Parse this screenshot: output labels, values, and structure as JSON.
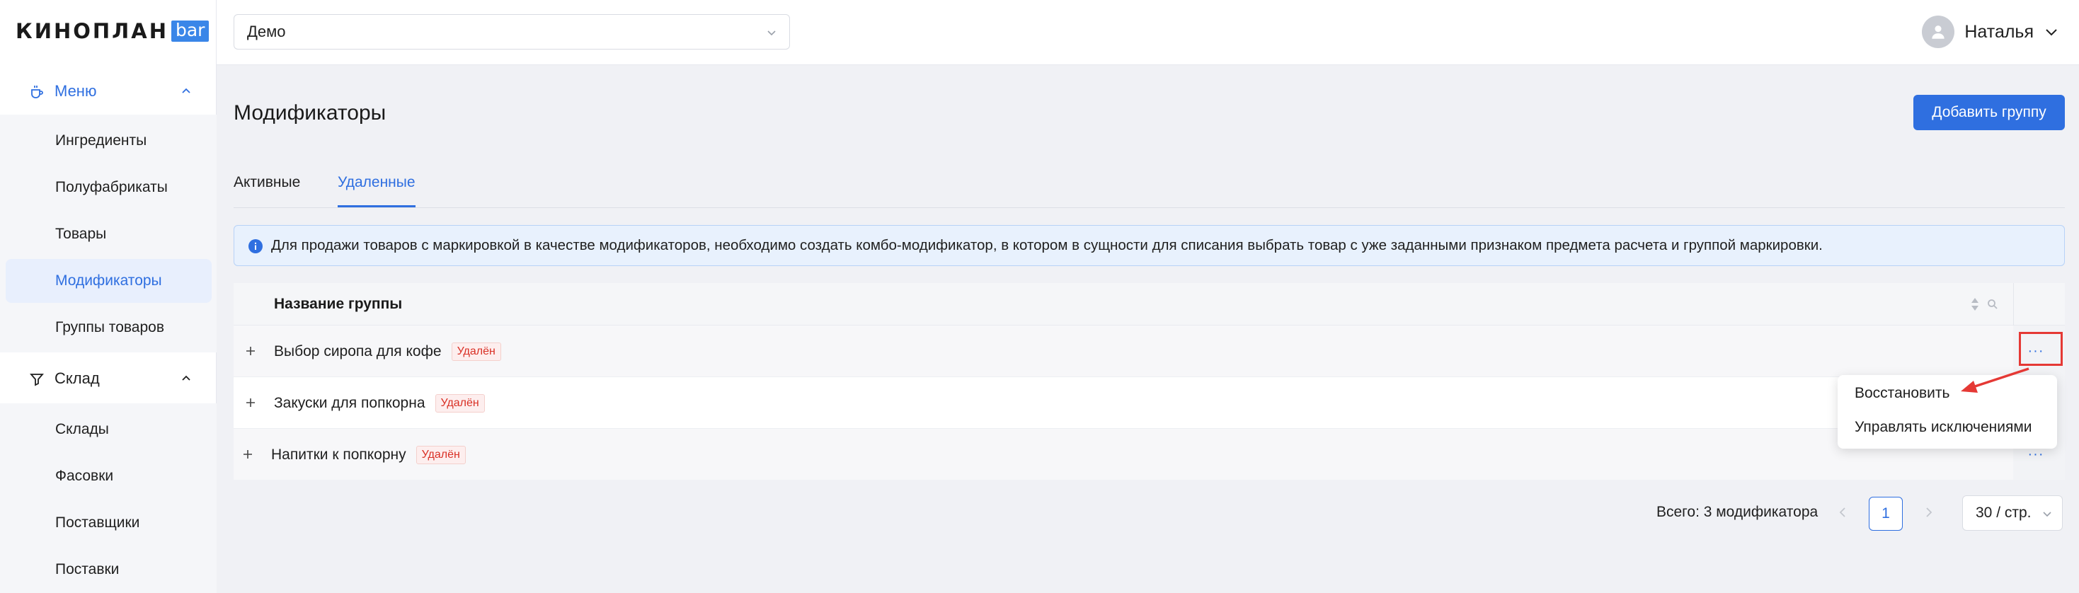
{
  "logo": {
    "text": "КИНОПЛАН",
    "badge": "bar"
  },
  "sidebar": {
    "menu_group": {
      "label": "Меню",
      "icon": "coffee-cup-icon",
      "items": [
        "Ингредиенты",
        "Полуфабрикаты",
        "Товары",
        "Модификаторы",
        "Группы товаров"
      ],
      "active_index": 3
    },
    "sklad_group": {
      "label": "Склад",
      "icon": "filter-icon",
      "items": [
        "Склады",
        "Фасовки",
        "Поставщики",
        "Поставки"
      ]
    }
  },
  "header": {
    "cinema_select": "Демо",
    "user_name": "Наталья"
  },
  "page": {
    "title": "Модификаторы",
    "add_button": "Добавить группу"
  },
  "tabs": [
    "Активные",
    "Удаленные"
  ],
  "active_tab": 1,
  "info_banner": "Для продажи товаров с маркировкой в качестве модификаторов, необходимо создать комбо-модификатор, в котором в сущности для списания выбрать товар с уже заданными признаком предмета расчета и группой маркировки.",
  "table": {
    "column_title": "Название группы",
    "rows": [
      {
        "name": "Выбор сиропа для кофе",
        "status": "Удалён"
      },
      {
        "name": "Закуски для попкорна",
        "status": "Удалён"
      },
      {
        "name": "Напитки к попкорну",
        "status": "Удалён"
      }
    ],
    "more_label": "···"
  },
  "context_menu": {
    "items": [
      "Восстановить",
      "Управлять исключениями"
    ]
  },
  "pagination": {
    "total": "Всего: 3 модификатора",
    "current_page": "1",
    "page_size": "30 / стр."
  },
  "colors": {
    "accent": "#2f6fe0",
    "danger": "#e53935",
    "badge_text": "#d93025"
  }
}
